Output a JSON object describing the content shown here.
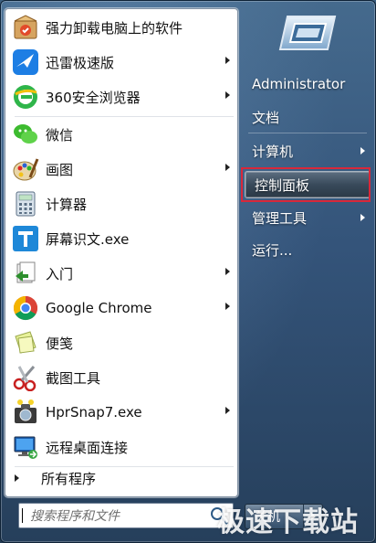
{
  "left_menu": {
    "items": [
      {
        "label": "强力卸载电脑上的软件",
        "icon": "uninstall-box-icon",
        "has_submenu": false
      },
      {
        "label": "迅雷极速版",
        "icon": "thunder-bird-icon",
        "has_submenu": true
      },
      {
        "label": "360安全浏览器",
        "icon": "360-browser-icon",
        "has_submenu": true
      },
      {
        "label": "微信",
        "icon": "wechat-icon",
        "has_submenu": false
      },
      {
        "label": "画图",
        "icon": "paint-palette-icon",
        "has_submenu": true
      },
      {
        "label": "计算器",
        "icon": "calculator-icon",
        "has_submenu": false
      },
      {
        "label": "屏幕识文.exe",
        "icon": "letter-t-icon",
        "has_submenu": false
      },
      {
        "label": "入门",
        "icon": "getting-started-icon",
        "has_submenu": true
      },
      {
        "label": "Google Chrome",
        "icon": "chrome-icon",
        "has_submenu": true
      },
      {
        "label": "便笺",
        "icon": "sticky-notes-icon",
        "has_submenu": false
      },
      {
        "label": "截图工具",
        "icon": "scissors-icon",
        "has_submenu": false
      },
      {
        "label": "HprSnap7.exe",
        "icon": "camera-icon",
        "has_submenu": true
      },
      {
        "label": "远程桌面连接",
        "icon": "remote-desktop-icon",
        "has_submenu": false
      }
    ],
    "all_programs": "所有程序"
  },
  "search": {
    "placeholder": "搜索程序和文件"
  },
  "right_menu": {
    "items": [
      {
        "label": "Administrator",
        "has_submenu": false
      },
      {
        "label": "文档",
        "has_submenu": false
      },
      {
        "label": "计算机",
        "has_submenu": true
      },
      {
        "label": "控制面板",
        "has_submenu": false,
        "highlighted": true
      },
      {
        "label": "管理工具",
        "has_submenu": true
      },
      {
        "label": "运行...",
        "has_submenu": false
      }
    ]
  },
  "shutdown": {
    "label": "关机"
  },
  "watermark": "极速下载站",
  "colors": {
    "highlight_border": "#d8283a",
    "panel_bg": "#ffffff",
    "frame": "#34547a"
  }
}
